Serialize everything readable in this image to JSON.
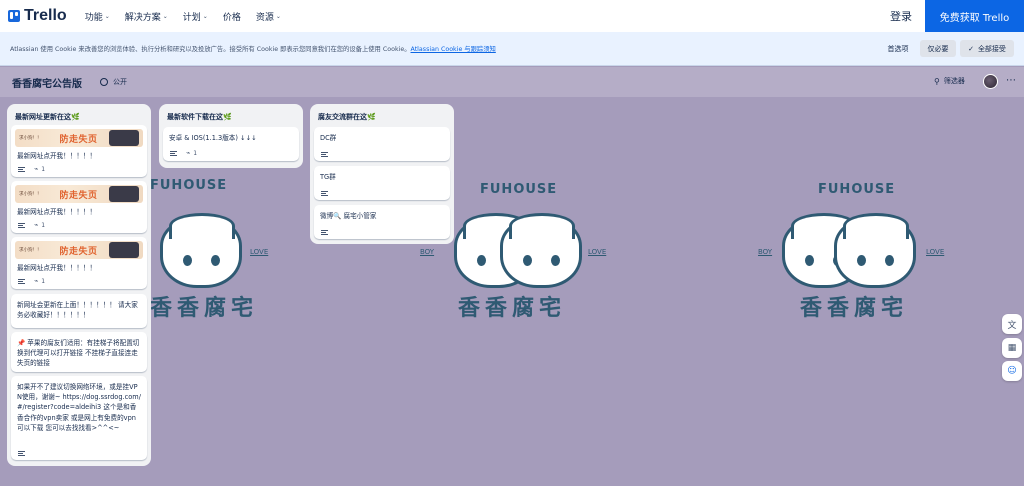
{
  "nav": {
    "logo_text": "Trello",
    "menu": [
      {
        "label": "功能",
        "has_caret": true
      },
      {
        "label": "解决方案",
        "has_caret": true
      },
      {
        "label": "计划",
        "has_caret": true
      },
      {
        "label": "价格",
        "has_caret": false
      },
      {
        "label": "资源",
        "has_caret": true
      }
    ],
    "login_label": "登录",
    "signup_label": "免费获取 Trello",
    "caret": "⌄"
  },
  "cookie": {
    "text": "Atlassian 使用 Cookie 来改善您的浏览体验、执行分析和研究以及投放广告。接受所有 Cookie 即表示您同意我们在您的设备上使用 Cookie。",
    "link": "Atlassian Cookie 与跟踪须知",
    "preferences_label": "首选项",
    "reject_label": "仅必要",
    "accept_label": "全部接受",
    "accept_check": "✓"
  },
  "board": {
    "title": "香香腐宅公告版",
    "visibility": "公开",
    "filter_label": "筛选器",
    "filter_icon": "⚲",
    "more_label": "⋯"
  },
  "lists": [
    {
      "title": "最新网址更新在这🌿",
      "cards": [
        {
          "text": "最新网址点开我！！！！！",
          "has_banner": true,
          "badge_count": "1",
          "has_description": true,
          "has_attachment": true
        },
        {
          "text": "最新网址点开我！！！！！",
          "has_banner": true,
          "badge_count": "1",
          "has_description": true,
          "has_attachment": true
        },
        {
          "text": "最新网址点开我！！！！！",
          "has_banner": true,
          "badge_count": "1",
          "has_description": true,
          "has_attachment": true
        },
        {
          "text": "新网址会更新在上面！！！！！！ 请大家务必收藏好！！！！！！",
          "has_banner": false
        },
        {
          "text": "📌 苹果的腐友们适用：有挂梯子将配置切换到代理可以打开链接 不挂梯子直接连走失页的链接",
          "has_banner": false
        },
        {
          "text": "如果开不了建议切换网络环境，或是挂VPN使用，谢谢~ https://dog.ssrdog.com/#/register?code=aldeihi3 这个是和香香合作的vpn卖家 或是网上有免费的vpn可以下载 您可以去找找看>^^<~",
          "has_banner": false,
          "has_description": true
        }
      ]
    },
    {
      "title": "最新软件下载在这🌿",
      "cards": [
        {
          "text": "安卓 & IOS(1.1.3版本) ↓↓↓",
          "badge_count": "1",
          "has_description": true,
          "has_attachment": true
        }
      ]
    },
    {
      "title": "腐友交流群在这🌿",
      "cards": [
        {
          "text": "DC群",
          "has_description": true
        },
        {
          "text": "TG群",
          "has_description": true
        },
        {
          "text": "微博🔍 腐宅小管家",
          "has_description": true
        }
      ]
    }
  ],
  "banner": {
    "small_text": "求小狗！！",
    "big_text": "防走失页"
  },
  "background_art": {
    "arc_text": "FUHOUSE",
    "left_label": "BOY",
    "right_label": "LOVE",
    "name_text": "香香腐宅",
    "colors": {
      "line": "#2f5a73",
      "board_bg": "#a59cbb"
    }
  },
  "side_buttons": [
    {
      "icon": "translate-icon",
      "glyph": "文"
    },
    {
      "icon": "qr-code-icon",
      "glyph": "▦"
    },
    {
      "icon": "chat-bot-icon",
      "glyph": "☺"
    }
  ],
  "colors": {
    "primary": "#0c66e4",
    "brand": "#1868db",
    "text": "#172b4d"
  }
}
